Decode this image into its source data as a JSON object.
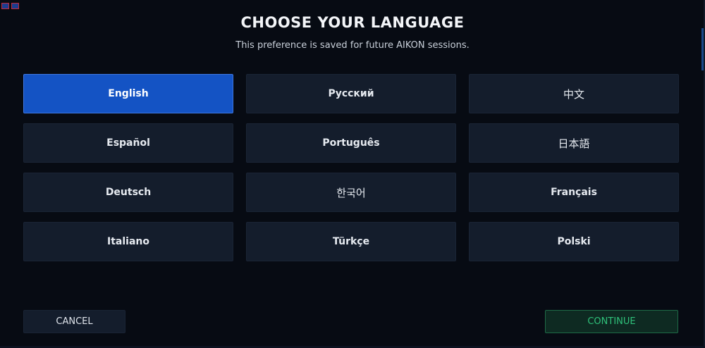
{
  "dialog": {
    "title": "CHOOSE YOUR LANGUAGE",
    "subtitle": "This preference is saved for future AIKON sessions."
  },
  "languages": [
    {
      "label": "English",
      "selected": true
    },
    {
      "label": "Русский",
      "selected": false
    },
    {
      "label": "中文",
      "selected": false
    },
    {
      "label": "Español",
      "selected": false
    },
    {
      "label": "Português",
      "selected": false
    },
    {
      "label": "日本語",
      "selected": false
    },
    {
      "label": "Deutsch",
      "selected": false
    },
    {
      "label": "한국어",
      "selected": false
    },
    {
      "label": "Français",
      "selected": false
    },
    {
      "label": "Italiano",
      "selected": false
    },
    {
      "label": "Türkçe",
      "selected": false
    },
    {
      "label": "Polski",
      "selected": false
    }
  ],
  "actions": {
    "cancel_label": "CANCEL",
    "continue_label": "CONTINUE"
  },
  "colors": {
    "background": "#070b13",
    "selected": "#1453c4",
    "button": "#141d2c",
    "continue_text": "#2fc17a"
  }
}
